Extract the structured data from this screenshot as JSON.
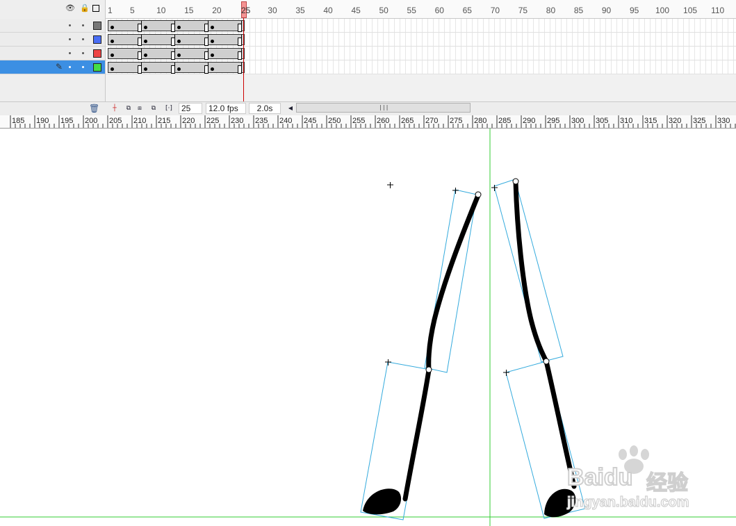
{
  "timeline": {
    "header_icons": [
      "eye-icon",
      "lock-icon",
      "outline-icon"
    ],
    "frame_numbers": [
      "1",
      "5",
      "10",
      "15",
      "20",
      "25",
      "30",
      "35",
      "40",
      "45",
      "50",
      "55",
      "60",
      "65",
      "70",
      "75",
      "80",
      "85",
      "90",
      "95",
      "100",
      "105",
      "110"
    ],
    "current_frame_marker": "25",
    "layers": [
      {
        "color": "#777777",
        "selected": false
      },
      {
        "color": "#4a6ef5",
        "selected": false
      },
      {
        "color": "#ee4444",
        "selected": false
      },
      {
        "color": "#44dd44",
        "selected": true
      }
    ],
    "status": {
      "current_frame": "25",
      "frame_rate": "12.0 fps",
      "elapsed_time": "2.0s"
    }
  },
  "stage_ruler": {
    "labels": [
      "185",
      "190",
      "195",
      "200",
      "205",
      "210",
      "215",
      "220",
      "225",
      "230",
      "235",
      "240",
      "245",
      "250",
      "255",
      "260",
      "265",
      "270",
      "275",
      "280",
      "285",
      "290",
      "295",
      "300",
      "305",
      "310",
      "315",
      "320",
      "325",
      "330"
    ]
  },
  "watermark": {
    "brand": "Baidu",
    "brand_cn": "经验",
    "url": "jingyan.baidu.com"
  },
  "colors": {
    "guide_green": "#33cc33",
    "bounding_box_cyan": "#33aadd",
    "stroke_black": "#000000",
    "selected_layer": "#3c8fe3"
  }
}
